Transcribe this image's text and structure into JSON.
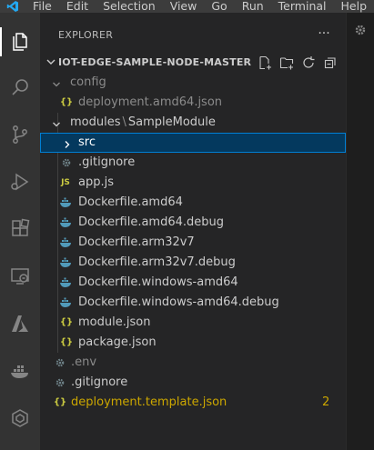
{
  "menu": [
    "File",
    "Edit",
    "Selection",
    "View",
    "Go",
    "Run",
    "Terminal",
    "Help"
  ],
  "colors": {
    "accent": "#007acc",
    "selection": "#04395e",
    "warning": "#cca700",
    "json": "#cbcb41",
    "js": "#cbcb41",
    "docker": "#519aba"
  },
  "activity_icons": [
    "explorer-icon",
    "search-icon",
    "source-control-icon",
    "run-debug-icon",
    "extensions-icon",
    "remote-explorer-icon",
    "azure-icon",
    "docker-icon",
    "azure-iot-icon"
  ],
  "sidebar": {
    "title": "EXPLORER",
    "more": "···",
    "section_title": "IOT-EDGE-SAMPLE-NODE-MASTER",
    "tools": [
      "new-file-icon",
      "new-folder-icon",
      "refresh-icon",
      "collapse-all-icon"
    ]
  },
  "tree": [
    {
      "label": "config",
      "type": "folder",
      "open": true,
      "dim": true
    },
    {
      "label": "deployment.amd64.json",
      "type": "json",
      "dim": true
    },
    {
      "label_parts": [
        "modules",
        "SampleModule"
      ],
      "type": "folder",
      "open": true
    },
    {
      "label": "src",
      "type": "folder",
      "open": false,
      "selected": true
    },
    {
      "label": ".gitignore",
      "type": "gear",
      "dim": false
    },
    {
      "label": "app.js",
      "type": "js"
    },
    {
      "label": "Dockerfile.amd64",
      "type": "docker"
    },
    {
      "label": "Dockerfile.amd64.debug",
      "type": "docker"
    },
    {
      "label": "Dockerfile.arm32v7",
      "type": "docker"
    },
    {
      "label": "Dockerfile.arm32v7.debug",
      "type": "docker"
    },
    {
      "label": "Dockerfile.windows-amd64",
      "type": "docker"
    },
    {
      "label": "Dockerfile.windows-amd64.debug",
      "type": "docker"
    },
    {
      "label": "module.json",
      "type": "json"
    },
    {
      "label": "package.json",
      "type": "json"
    },
    {
      "label": ".env",
      "type": "gear",
      "dim": true
    },
    {
      "label": ".gitignore",
      "type": "gear",
      "dim": false
    },
    {
      "label": "deployment.template.json",
      "type": "json",
      "warning": true,
      "badge": "2"
    }
  ],
  "icon_glyphs": {
    "js": "JS"
  },
  "modules_separator": "\\"
}
